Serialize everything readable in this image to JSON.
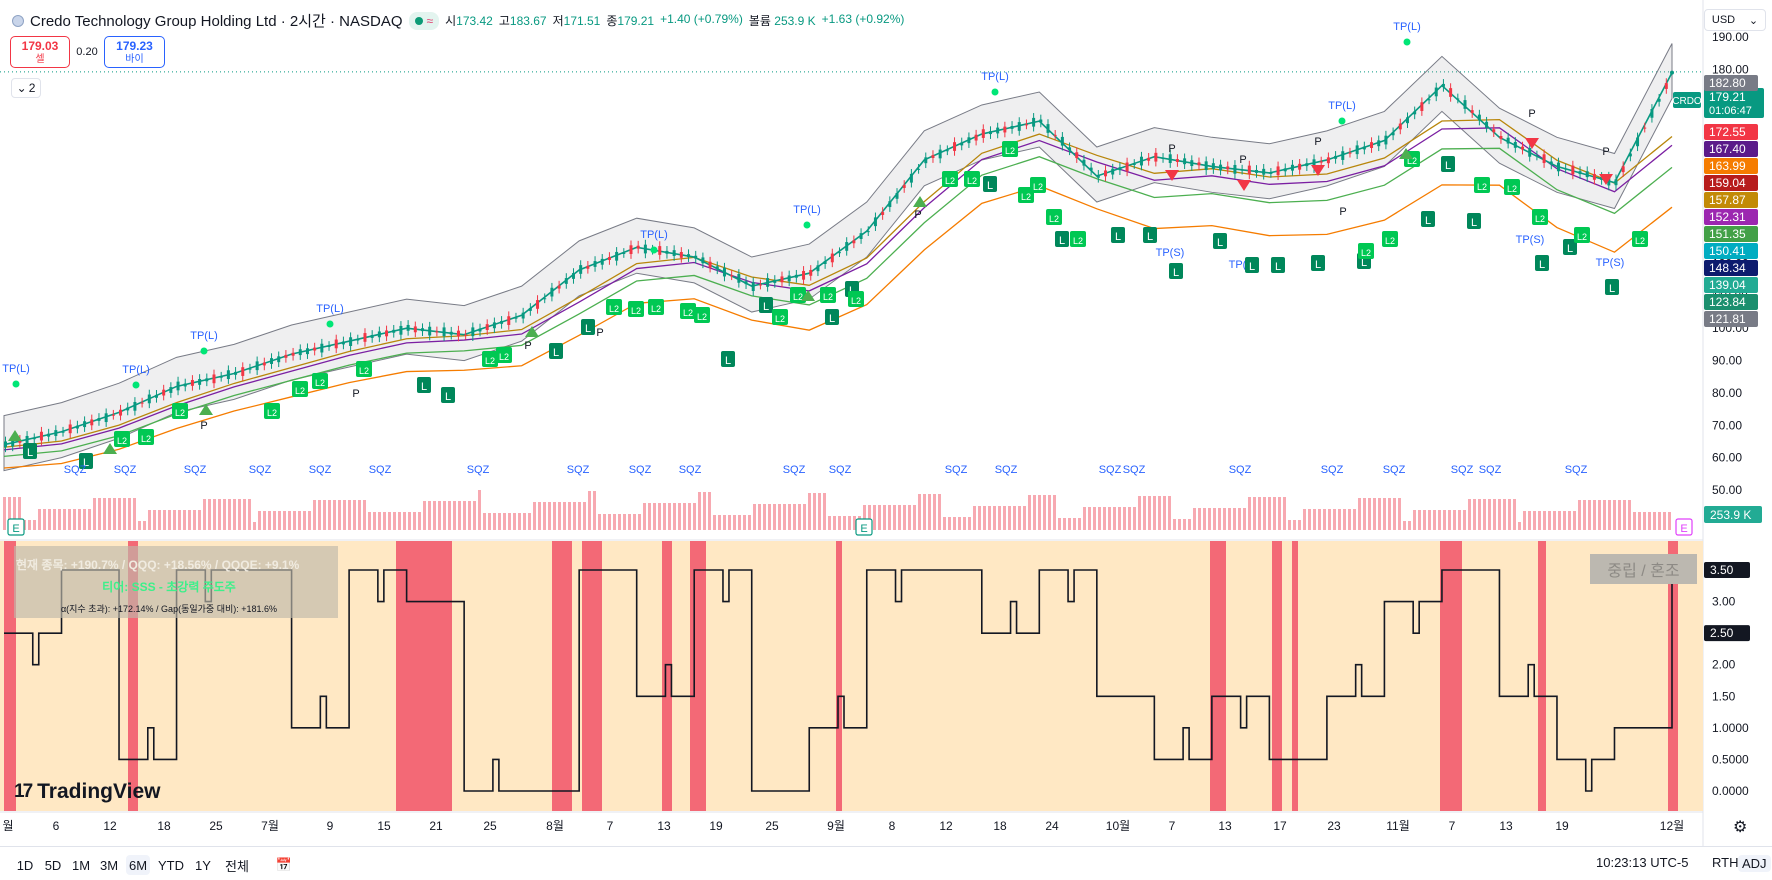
{
  "header": {
    "title": "Credo Technology Group Holding Ltd · 2시간 · NASDAQ",
    "status_wave": "≈",
    "open_label": "시",
    "open": "173.42",
    "high_label": "고",
    "high": "183.67",
    "low_label": "저",
    "low": "171.51",
    "close_label": "종",
    "close": "179.21",
    "change": "+1.40 (+0.79%)",
    "volume_label": "볼륨",
    "volume": "253.9 K",
    "volume_change": "+1.63 (+0.92%)"
  },
  "trade": {
    "sell_price": "179.03",
    "sell_label": "셀",
    "spread": "0.20",
    "buy_price": "179.23",
    "buy_label": "바이"
  },
  "collapse_count": "2",
  "currency": "USD",
  "price_axis": {
    "ticks": [
      "190.00",
      "180.00",
      "170.00",
      "160.00",
      "150.00",
      "140.00",
      "130.00",
      "120.00",
      "110.00",
      "100.00",
      "90.00",
      "80.00",
      "70.00",
      "60.00",
      "50.00"
    ],
    "ticker_tag": "CRDO",
    "current_price": "179.21",
    "countdown": "01:06:47",
    "tags": [
      {
        "value": "182.80",
        "color": "#787b86"
      },
      {
        "value": "172.55",
        "color": "#f23645"
      },
      {
        "value": "167.40",
        "color": "#5b1a8a"
      },
      {
        "value": "163.99",
        "color": "#f57c00"
      },
      {
        "value": "159.04",
        "color": "#b71c1c"
      },
      {
        "value": "157.87",
        "color": "#c28a06"
      },
      {
        "value": "152.31",
        "color": "#9c27b0"
      },
      {
        "value": "151.35",
        "color": "#43a047"
      },
      {
        "value": "150.41",
        "color": "#00acc1"
      },
      {
        "value": "148.34",
        "color": "#0d1b6e"
      },
      {
        "value": "139.04",
        "color": "#22ab94"
      },
      {
        "value": "123.84",
        "color": "#1b8f6e"
      },
      {
        "value": "121.81",
        "color": "#787b86"
      }
    ],
    "volume_tag": "253.9 K"
  },
  "indicator": {
    "ticks": [
      "3.50",
      "3.00",
      "2.50",
      "2.00",
      "1.50",
      "1.0000",
      "0.5000",
      "0.0000"
    ],
    "highlight_350": "3.50",
    "highlight_250": "2.50",
    "line1": "현재 종목: +190.7% / QQQ: +18.56% / QQQE: +9.1%",
    "line2": "티어: SSS - 초강력 주도주",
    "line3": "α(지수 초과): +172.14% / Gap(동일가중 대비): +181.6%",
    "state_label": "중립 / 혼조"
  },
  "time_axis": {
    "labels": [
      "월",
      "6",
      "12",
      "18",
      "25",
      "7월",
      "9",
      "15",
      "21",
      "25",
      "8월",
      "7",
      "13",
      "19",
      "25",
      "9월",
      "8",
      "12",
      "18",
      "24",
      "10월",
      "7",
      "13",
      "17",
      "23",
      "11월",
      "7",
      "13",
      "19",
      "12월"
    ]
  },
  "chart_labels": {
    "tp_long": "TP(L)",
    "tp_short": "TP(S)",
    "long": "L",
    "long2": "L2",
    "p_label": "P",
    "squeeze": "SQZ",
    "earnings": "E"
  },
  "timeframes": [
    "1D",
    "5D",
    "1M",
    "3M",
    "6M",
    "YTD",
    "1Y",
    "전체"
  ],
  "active_timeframe": "6M",
  "footer": {
    "clock": "10:23:13 UTC-5",
    "session": "RTH",
    "adjust": "ADJ"
  },
  "brand": "TradingView",
  "chart_data": {
    "type": "line",
    "title": "Credo Technology Group Holding Ltd · 2시간 · NASDAQ",
    "xlabel": "",
    "ylabel": "",
    "ylim": [
      50,
      190
    ],
    "x": [
      "월",
      "6",
      "12",
      "18",
      "25",
      "7월",
      "9",
      "15",
      "21",
      "25",
      "8월",
      "7",
      "13",
      "19",
      "25",
      "9월",
      "8",
      "12",
      "18",
      "24",
      "10월",
      "7",
      "13",
      "17",
      "23",
      "11월",
      "7",
      "13",
      "19",
      "12월"
    ],
    "series": [
      {
        "values": [
          64,
          68,
          74,
          82,
          86,
          92,
          96,
          100,
          98,
          104,
          118,
          125,
          122,
          113,
          117,
          130,
          152,
          160,
          164,
          147,
          153,
          150,
          148,
          152,
          158,
          175,
          159,
          150,
          145,
          179
        ]
      }
    ],
    "indicator_values": [
      2.5,
      3.5,
      0.5,
      3.5,
      3.5,
      1.0,
      3.5,
      3.0,
      0.0,
      0.0,
      3.5,
      1.5,
      3.5,
      0.0,
      1.0,
      3.5,
      3.5,
      2.5,
      3.5,
      1.5,
      0.5,
      1.5,
      0.5,
      1.5,
      3.0,
      3.5,
      1.5,
      0.5,
      1.0,
      3.5
    ]
  }
}
